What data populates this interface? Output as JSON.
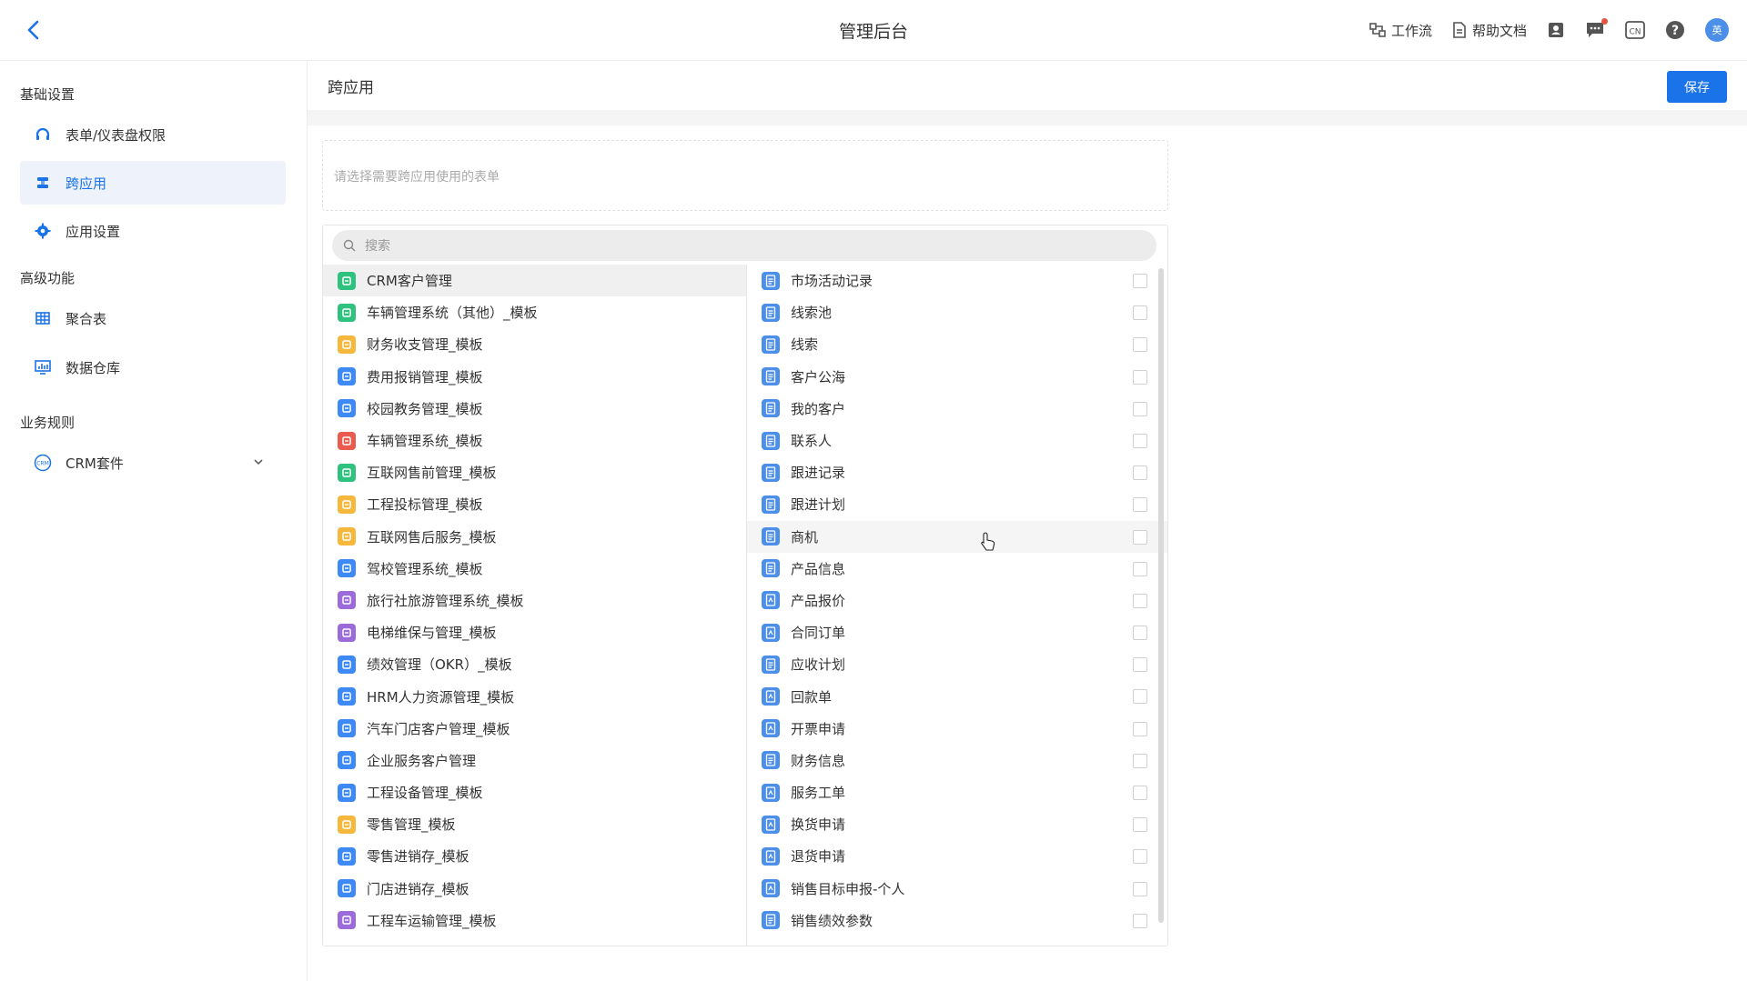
{
  "header": {
    "title": "管理后台",
    "workflow_label": "工作流",
    "help_label": "帮助文档",
    "lang_label": "CN",
    "avatar_text": "英"
  },
  "sidebar": {
    "sections": [
      {
        "label": "基础设置"
      },
      {
        "label": "高级功能"
      },
      {
        "label": "业务规则"
      }
    ],
    "items": [
      {
        "label": "表单/仪表盘权限",
        "icon": "headset-icon"
      },
      {
        "label": "跨应用",
        "icon": "cross-app-icon",
        "active": true
      },
      {
        "label": "应用设置",
        "icon": "gear-icon"
      },
      {
        "label": "聚合表",
        "icon": "grid-icon"
      },
      {
        "label": "数据仓库",
        "icon": "monitor-chart-icon"
      },
      {
        "label": "CRM套件",
        "icon": "crm-icon"
      }
    ]
  },
  "main": {
    "title": "跨应用",
    "save_label": "保存",
    "selected_placeholder": "请选择需要跨应用使用的表单",
    "search_placeholder": "搜索",
    "apps": [
      {
        "label": "CRM客户管理",
        "color": "#2ec27e"
      },
      {
        "label": "车辆管理系统（其他）_模板",
        "color": "#2ec27e"
      },
      {
        "label": "财务收支管理_模板",
        "color": "#f5b83d"
      },
      {
        "label": "费用报销管理_模板",
        "color": "#3d8af7"
      },
      {
        "label": "校园教务管理_模板",
        "color": "#3d8af7"
      },
      {
        "label": "车辆管理系统_模板",
        "color": "#ea5a4f"
      },
      {
        "label": "互联网售前管理_模板",
        "color": "#2ec27e"
      },
      {
        "label": "工程投标管理_模板",
        "color": "#f5b83d"
      },
      {
        "label": "互联网售后服务_模板",
        "color": "#f5b83d"
      },
      {
        "label": "驾校管理系统_模板",
        "color": "#3d8af7"
      },
      {
        "label": "旅行社旅游管理系统_模板",
        "color": "#9b6cd9"
      },
      {
        "label": "电梯维保与管理_模板",
        "color": "#9b6cd9"
      },
      {
        "label": "绩效管理（OKR）_模板",
        "color": "#3d8af7"
      },
      {
        "label": "HRM人力资源管理_模板",
        "color": "#3d8af7"
      },
      {
        "label": "汽车门店客户管理_模板",
        "color": "#3d8af7"
      },
      {
        "label": "企业服务客户管理",
        "color": "#3d8af7"
      },
      {
        "label": "工程设备管理_模板",
        "color": "#3d8af7"
      },
      {
        "label": "零售管理_模板",
        "color": "#f5b83d"
      },
      {
        "label": "零售进销存_模板",
        "color": "#3d8af7"
      },
      {
        "label": "门店进销存_模板",
        "color": "#3d8af7"
      },
      {
        "label": "工程车运输管理_模板",
        "color": "#9b6cd9"
      }
    ],
    "forms": [
      {
        "label": "市场活动记录",
        "icon": "doc-icon"
      },
      {
        "label": "线索池",
        "icon": "doc-icon"
      },
      {
        "label": "线索",
        "icon": "doc-icon"
      },
      {
        "label": "客户公海",
        "icon": "doc-icon"
      },
      {
        "label": "我的客户",
        "icon": "doc-icon"
      },
      {
        "label": "联系人",
        "icon": "doc-icon"
      },
      {
        "label": "跟进记录",
        "icon": "doc-icon"
      },
      {
        "label": "跟进计划",
        "icon": "doc-icon"
      },
      {
        "label": "商机",
        "icon": "doc-icon"
      },
      {
        "label": "产品信息",
        "icon": "doc-icon"
      },
      {
        "label": "产品报价",
        "icon": "flow-doc-icon"
      },
      {
        "label": "合同订单",
        "icon": "flow-doc-icon"
      },
      {
        "label": "应收计划",
        "icon": "doc-icon"
      },
      {
        "label": "回款单",
        "icon": "flow-doc-icon"
      },
      {
        "label": "开票申请",
        "icon": "flow-doc-icon"
      },
      {
        "label": "财务信息",
        "icon": "doc-icon"
      },
      {
        "label": "服务工单",
        "icon": "flow-doc-icon"
      },
      {
        "label": "换货申请",
        "icon": "flow-doc-icon"
      },
      {
        "label": "退货申请",
        "icon": "flow-doc-icon"
      },
      {
        "label": "销售目标申报-个人",
        "icon": "flow-doc-icon"
      },
      {
        "label": "销售绩效参数",
        "icon": "doc-icon"
      }
    ]
  }
}
